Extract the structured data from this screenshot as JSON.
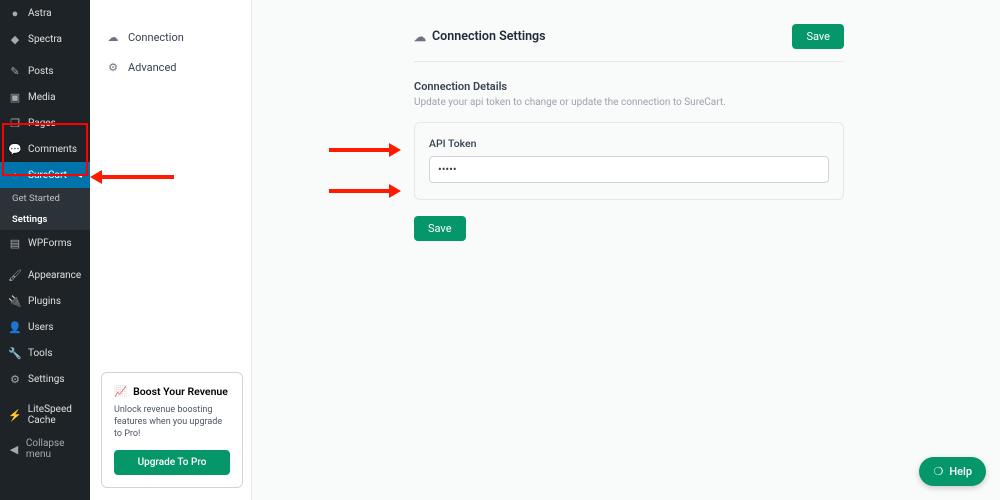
{
  "wp_sidebar": {
    "items": [
      {
        "label": "Astra",
        "icon": "●"
      },
      {
        "label": "Spectra",
        "icon": "◆"
      },
      {
        "label": "Posts",
        "icon": "✎"
      },
      {
        "label": "Media",
        "icon": "▣"
      },
      {
        "label": "Pages",
        "icon": "❐"
      },
      {
        "label": "Comments",
        "icon": "💬"
      },
      {
        "label": "SureCart",
        "icon": "◔"
      },
      {
        "label": "WPForms",
        "icon": "▤"
      },
      {
        "label": "Appearance",
        "icon": "🖌"
      },
      {
        "label": "Plugins",
        "icon": "🔌"
      },
      {
        "label": "Users",
        "icon": "👤"
      },
      {
        "label": "Tools",
        "icon": "🔧"
      },
      {
        "label": "Settings",
        "icon": "⚙"
      },
      {
        "label": "LiteSpeed Cache",
        "icon": "⚡"
      },
      {
        "label": "Collapse menu",
        "icon": "◀"
      }
    ],
    "surecart_sub": [
      {
        "label": "Get Started"
      },
      {
        "label": "Settings"
      }
    ]
  },
  "tabs": {
    "connection": {
      "label": "Connection"
    },
    "advanced": {
      "label": "Advanced"
    }
  },
  "page": {
    "title": "Connection Settings",
    "save_button": "Save",
    "details_title": "Connection Details",
    "details_desc": "Update your api token to change or update the connection to SureCart.",
    "api_label": "API Token",
    "api_value": "•••••",
    "save2": "Save"
  },
  "upsell": {
    "title": "Boost Your Revenue",
    "body": "Unlock revenue boosting features when you upgrade to Pro!",
    "cta": "Upgrade To Pro"
  },
  "help": {
    "label": "Help"
  }
}
